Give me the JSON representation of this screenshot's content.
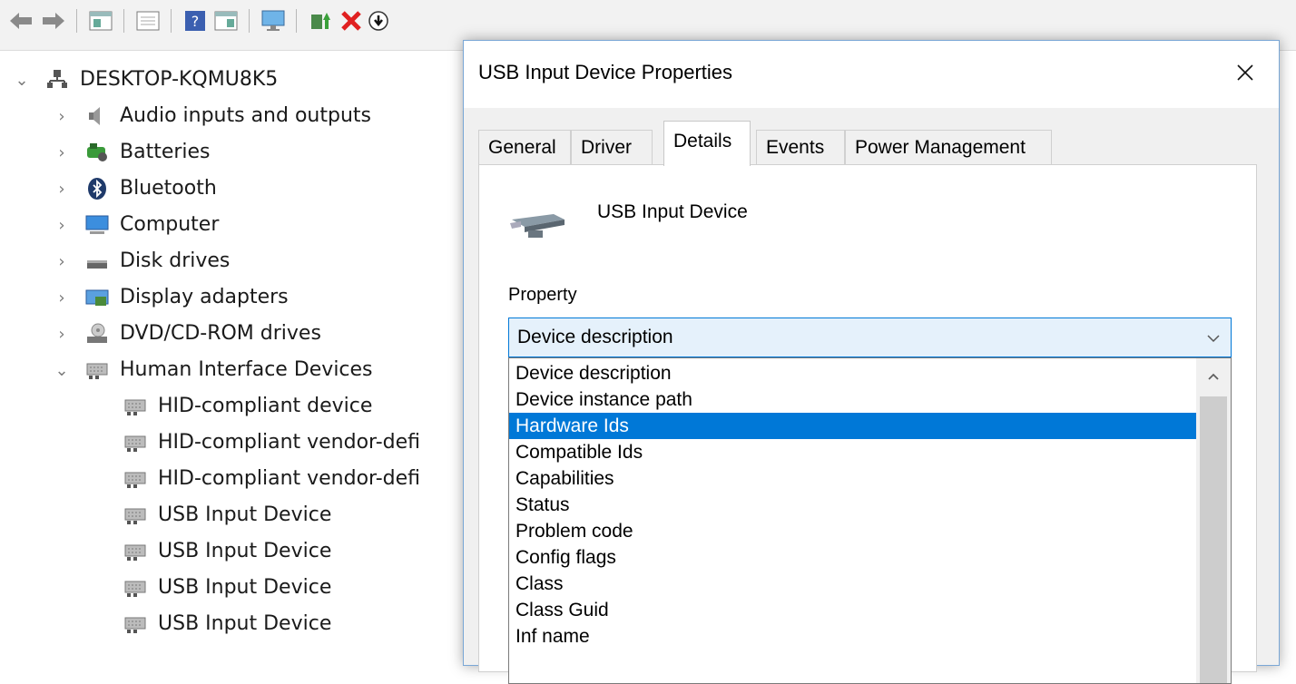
{
  "toolbar": {
    "buttons": [
      "back-arrow-icon",
      "forward-arrow-icon",
      "properties-pane-icon",
      "show-hide-console-tree-icon",
      "help-icon",
      "action-pane-icon",
      "monitor-icon",
      "update-driver-icon",
      "uninstall-icon",
      "scan-hardware-icon"
    ]
  },
  "tree": {
    "root": "DESKTOP-KQMU8K5",
    "categories": [
      {
        "label": "Audio inputs and outputs"
      },
      {
        "label": "Batteries"
      },
      {
        "label": "Bluetooth"
      },
      {
        "label": "Computer"
      },
      {
        "label": "Disk drives"
      },
      {
        "label": "Display adapters"
      },
      {
        "label": "DVD/CD-ROM drives"
      },
      {
        "label": "Human Interface Devices"
      }
    ],
    "hid_children": [
      {
        "label": "HID-compliant device"
      },
      {
        "label": "HID-compliant vendor-defi"
      },
      {
        "label": "HID-compliant vendor-defi"
      },
      {
        "label": "USB Input Device"
      },
      {
        "label": "USB Input Device"
      },
      {
        "label": "USB Input Device"
      },
      {
        "label": "USB Input Device"
      }
    ]
  },
  "dialog": {
    "title": "USB Input Device Properties",
    "tabs": [
      "General",
      "Driver",
      "Details",
      "Events",
      "Power Management"
    ],
    "active_tab": "Details",
    "device_name": "USB Input Device",
    "property_label": "Property",
    "selected_property": "Device description",
    "options": [
      "Device description",
      "Device instance path",
      "Hardware Ids",
      "Compatible Ids",
      "Capabilities",
      "Status",
      "Problem code",
      "Config flags",
      "Class",
      "Class Guid",
      "Inf name"
    ],
    "highlighted_option": "Hardware Ids"
  },
  "colors": {
    "selection": "#0078d7",
    "combo_bg": "#e5f1fb",
    "dialog_bg": "#f0f0f0"
  }
}
